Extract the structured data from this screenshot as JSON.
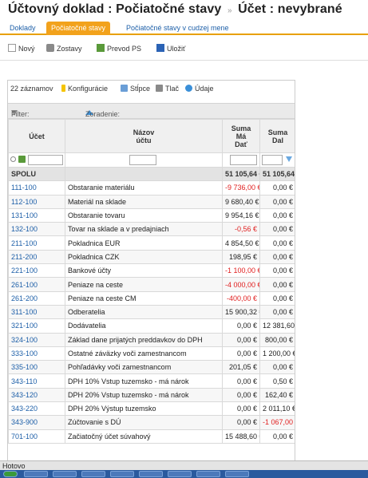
{
  "header": {
    "title": "Účtovný doklad :",
    "subtitle": "Počiatočné stavy",
    "separator": "»",
    "account_label": "Účet :",
    "account_value": "nevybrané"
  },
  "tabs": [
    {
      "label": "Doklady",
      "active": false
    },
    {
      "label": "Počiatočné stavy",
      "active": true
    },
    {
      "label": "Počiatočné stavy v cudzej mene",
      "active": false
    }
  ],
  "toolbar": {
    "new_label": "Nový",
    "reports_label": "Zostavy",
    "transfer_label": "Prevod PS",
    "save_label": "Uložiť"
  },
  "grid_toolbar": {
    "count_label": "22 záznamov",
    "config_label": "Konfigurácie",
    "columns_label": "Stĺpce",
    "print_label": "Tlač",
    "data_label": "Údaje",
    "filter_label": "Filter:",
    "sort_label": "Zoradenie:"
  },
  "columns": {
    "account": "Účet",
    "name_line1": "Názov",
    "name_line2": "účtu",
    "debit_line1": "Suma",
    "debit_line2": "Má",
    "debit_line3": "Dať",
    "credit_line1": "Suma",
    "credit_line2": "Dal"
  },
  "total": {
    "label": "SPOLU",
    "debit": "51 105,64 €",
    "credit": "51 105,64 €"
  },
  "rows": [
    {
      "acct": "111-100",
      "name": "Obstaranie materiálu",
      "debit": "-9 736,00 €",
      "credit": "0,00 €",
      "debit_neg": true,
      "credit_neg": false
    },
    {
      "acct": "112-100",
      "name": "Materiál na sklade",
      "debit": "9 680,40 €",
      "credit": "0,00 €",
      "debit_neg": false,
      "credit_neg": false
    },
    {
      "acct": "131-100",
      "name": "Obstaranie tovaru",
      "debit": "9 954,16 €",
      "credit": "0,00 €",
      "debit_neg": false,
      "credit_neg": false
    },
    {
      "acct": "132-100",
      "name": "Tovar na sklade a v predajniach",
      "debit": "-0,56 €",
      "credit": "0,00 €",
      "debit_neg": true,
      "credit_neg": false
    },
    {
      "acct": "211-100",
      "name": "Pokladnica EUR",
      "debit": "4 854,50 €",
      "credit": "0,00 €",
      "debit_neg": false,
      "credit_neg": false
    },
    {
      "acct": "211-200",
      "name": "Pokladnica CZK",
      "debit": "198,95 €",
      "credit": "0,00 €",
      "debit_neg": false,
      "credit_neg": false
    },
    {
      "acct": "221-100",
      "name": "Bankové účty",
      "debit": "-1 100,00 €",
      "credit": "0,00 €",
      "debit_neg": true,
      "credit_neg": false
    },
    {
      "acct": "261-100",
      "name": "Peniaze na ceste",
      "debit": "-4 000,00 €",
      "credit": "0,00 €",
      "debit_neg": true,
      "credit_neg": false
    },
    {
      "acct": "261-200",
      "name": "Peniaze na ceste CM",
      "debit": "-400,00 €",
      "credit": "0,00 €",
      "debit_neg": true,
      "credit_neg": false
    },
    {
      "acct": "311-100",
      "name": "Odberatelia",
      "debit": "15 900,32 €",
      "credit": "0,00 €",
      "debit_neg": false,
      "credit_neg": false
    },
    {
      "acct": "321-100",
      "name": "Dodávatelia",
      "debit": "0,00 €",
      "credit": "12 381,60 €",
      "debit_neg": false,
      "credit_neg": false
    },
    {
      "acct": "324-100",
      "name": "Základ dane prijatých preddavkov do DPH",
      "debit": "0,00 €",
      "credit": "800,00 €",
      "debit_neg": false,
      "credit_neg": false
    },
    {
      "acct": "333-100",
      "name": "Ostatné záväzky voči zamestnancom",
      "debit": "0,00 €",
      "credit": "1 200,00 €",
      "debit_neg": false,
      "credit_neg": false
    },
    {
      "acct": "335-100",
      "name": "Pohľadávky voči zamestnancom",
      "debit": "201,05 €",
      "credit": "0,00 €",
      "debit_neg": false,
      "credit_neg": false
    },
    {
      "acct": "343-110",
      "name": "DPH 10% Vstup tuzemsko - má nárok",
      "debit": "0,00 €",
      "credit": "0,50 €",
      "debit_neg": false,
      "credit_neg": false
    },
    {
      "acct": "343-120",
      "name": "DPH 20% Vstup tuzemsko - má nárok",
      "debit": "0,00 €",
      "credit": "162,40 €",
      "debit_neg": false,
      "credit_neg": false
    },
    {
      "acct": "343-220",
      "name": "DPH 20% Výstup tuzemsko",
      "debit": "0,00 €",
      "credit": "2 011,10 €",
      "debit_neg": false,
      "credit_neg": false
    },
    {
      "acct": "343-900",
      "name": "Zúčtovanie s DÚ",
      "debit": "0,00 €",
      "credit": "-1 067,00 €",
      "debit_neg": false,
      "credit_neg": true
    },
    {
      "acct": "701-100",
      "name": "Začiatočný účet súvahový",
      "debit": "15 488,60 €",
      "credit": "0,00 €",
      "debit_neg": false,
      "credit_neg": false
    }
  ],
  "status": {
    "text": "Hotovo"
  },
  "colors": {
    "accent": "#f2a21c",
    "link": "#1d5fa8",
    "negative": "#e02020"
  }
}
